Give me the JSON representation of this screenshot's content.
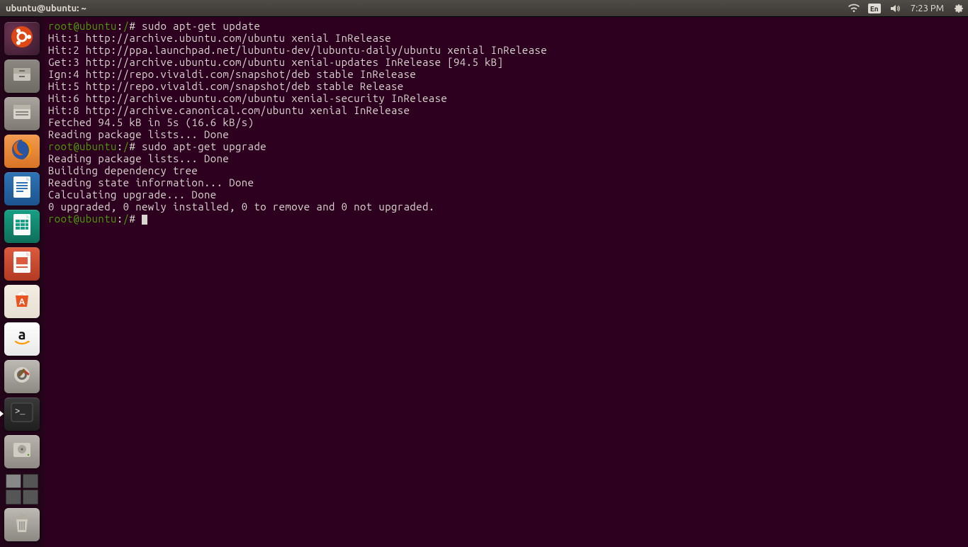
{
  "top_panel": {
    "window_title": "ubuntu@ubuntu: ~",
    "lang": "En",
    "clock": "7:23 PM"
  },
  "launcher": {
    "items": [
      {
        "name": "dash",
        "label": "Dash"
      },
      {
        "name": "nautilus-home",
        "label": "Home"
      },
      {
        "name": "nautilus-files",
        "label": "Files"
      },
      {
        "name": "firefox",
        "label": "Firefox"
      },
      {
        "name": "libreoffice-writer",
        "label": "Writer"
      },
      {
        "name": "libreoffice-calc",
        "label": "Calc"
      },
      {
        "name": "libreoffice-impress",
        "label": "Impress"
      },
      {
        "name": "ubuntu-software",
        "label": "Software"
      },
      {
        "name": "amazon",
        "label": "Amazon"
      },
      {
        "name": "system-settings",
        "label": "Settings"
      },
      {
        "name": "terminal",
        "label": "Terminal"
      },
      {
        "name": "disk",
        "label": "Disk"
      }
    ],
    "trash_label": "Trash"
  },
  "terminal": {
    "prompt_user": "root@ubuntu",
    "prompt_path": "/",
    "lines": [
      {
        "prompt": true,
        "cmd": "sudo apt-get update"
      },
      {
        "text": "Hit:1 http://archive.ubuntu.com/ubuntu xenial InRelease"
      },
      {
        "text": "Hit:2 http://ppa.launchpad.net/lubuntu-dev/lubuntu-daily/ubuntu xenial InRelease"
      },
      {
        "text": "Get:3 http://archive.ubuntu.com/ubuntu xenial-updates InRelease [94.5 kB]"
      },
      {
        "text": "Ign:4 http://repo.vivaldi.com/snapshot/deb stable InRelease"
      },
      {
        "text": "Hit:5 http://repo.vivaldi.com/snapshot/deb stable Release"
      },
      {
        "text": "Hit:6 http://archive.ubuntu.com/ubuntu xenial-security InRelease"
      },
      {
        "text": "Hit:8 http://archive.canonical.com/ubuntu xenial InRelease"
      },
      {
        "text": "Fetched 94.5 kB in 5s (16.6 kB/s)"
      },
      {
        "text": "Reading package lists... Done"
      },
      {
        "prompt": true,
        "cmd": "sudo apt-get upgrade"
      },
      {
        "text": "Reading package lists... Done"
      },
      {
        "text": "Building dependency tree"
      },
      {
        "text": "Reading state information... Done"
      },
      {
        "text": "Calculating upgrade... Done"
      },
      {
        "text": "0 upgraded, 0 newly installed, 0 to remove and 0 not upgraded."
      },
      {
        "prompt": true,
        "cmd": "",
        "cursor": true
      }
    ]
  }
}
